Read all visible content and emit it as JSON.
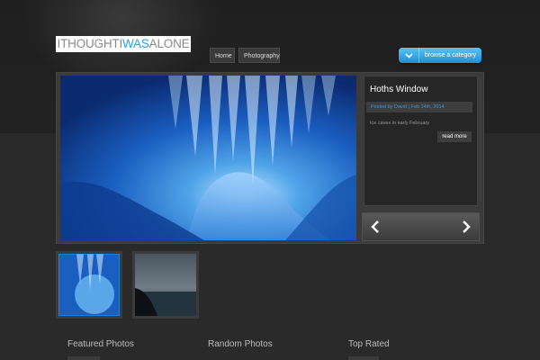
{
  "logo": {
    "part1": "ITHOUGHTI",
    "part2": "WAS",
    "part3": "ALONE"
  },
  "nav": {
    "items": [
      {
        "label": "Home"
      },
      {
        "label": "Photography"
      }
    ]
  },
  "browse": {
    "label": "browse a category",
    "icon": "chevron-down-icon"
  },
  "slide": {
    "title": "Hoths Window",
    "meta": "Posted by David | Feb 14th, 2014",
    "caption": "Ice caves in early February",
    "read_more": "read more"
  },
  "slider_controls": {
    "prev_icon": "arrow-left-icon",
    "next_icon": "arrow-right-icon"
  },
  "sections": [
    {
      "title": "Featured Photos"
    },
    {
      "title": "Random Photos"
    },
    {
      "title": "Top Rated"
    }
  ],
  "colors": {
    "accent": "#2aa3de",
    "button_blue": "#1c8fd6",
    "background": "#262626"
  }
}
